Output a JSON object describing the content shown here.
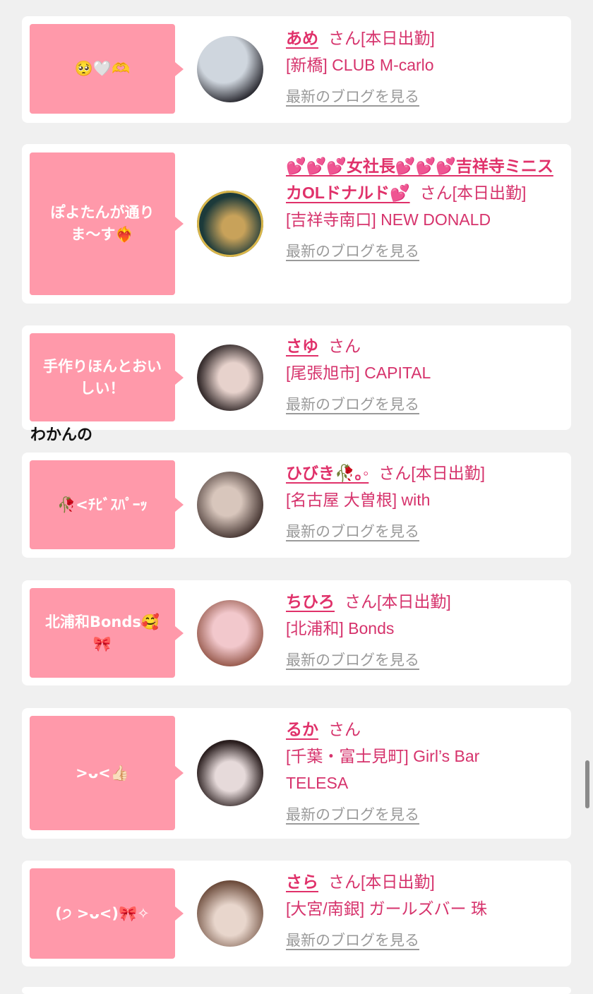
{
  "entries": [
    {
      "bubble": "🥺🤍🫶",
      "name": "あめ",
      "honorific": "さん",
      "status": "[本日出勤]",
      "shop": "[新橋] CLUB M-carlo",
      "blog_link": "最新のブログを見る",
      "avatar_colors": [
        "#cfd6de",
        "#2e2e35"
      ]
    },
    {
      "bubble": "ぽよたんが通りま〜す❤️‍🔥",
      "name": "💕💕💕女社長💕💕💕吉祥寺ミニスカOLドナルド💕",
      "honorific": "さん",
      "status": "[本日出勤]",
      "shop": "[吉祥寺南口] NEW DONALD",
      "blog_link": "最新のブログを見る",
      "avatar_colors": [
        "#1c3a3a",
        "#c8a25a"
      ]
    },
    {
      "bubble": "手作りほんとおいしい！",
      "name": "さゆ",
      "honorific": "さん",
      "status": "",
      "shop": "[尾張旭市] CAPITAL",
      "blog_link": "最新のブログを見る",
      "avatar_colors": [
        "#3a3030",
        "#e7d2cc"
      ]
    },
    {
      "bubble": "🥀<ﾁﾋﾞｽﾊﾟｰｯ",
      "name": "ひびき🥀｡◦",
      "honorific": "さん",
      "status": "[本日出勤]",
      "shop": "[名古屋 大曽根] with",
      "blog_link": "最新のブログを見る",
      "avatar_colors": [
        "#4a3a36",
        "#d8c6bc"
      ]
    },
    {
      "bubble": "北浦和Bonds🥰🎀",
      "name": "ちひろ",
      "honorific": "さん",
      "status": "[本日出勤]",
      "shop": "[北浦和] Bonds",
      "blog_link": "最新のブログを見る",
      "avatar_colors": [
        "#f2c8cc",
        "#8a4a3a"
      ]
    },
    {
      "bubble": ">ᴗ<👍🏻",
      "name": "るか",
      "honorific": "さん",
      "status": "",
      "shop": "[千葉・富士見町] Girl’s Bar TELESA",
      "blog_link": "最新のブログを見る",
      "avatar_colors": [
        "#2a1e1e",
        "#e6dada"
      ]
    },
    {
      "bubble": "(੭ >ᴗ<)🎀✧",
      "name": "さら",
      "honorific": "さん",
      "status": "[本日出勤]",
      "shop": "[大宮/南銀] ガールズバー 珠",
      "blog_link": "最新のブログを見る",
      "avatar_colors": [
        "#6b4a3a",
        "#e8d6cc"
      ]
    }
  ],
  "floating_label": "わかんの",
  "colors": {
    "bubble": "#ff99aa",
    "name": "#e0316a",
    "text": "#d6336c",
    "link": "#9a9a9a",
    "background": "#f0f0f0"
  }
}
